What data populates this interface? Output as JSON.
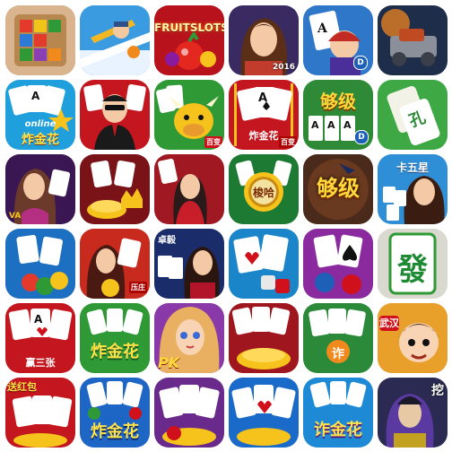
{
  "tiles": {
    "fruit_slots": {
      "title": "FRUITSLOTS"
    },
    "heroine_game": {
      "year": "2016"
    },
    "hero_d": {
      "badge": "D"
    },
    "zha_jin_hua_online": {
      "online": "online",
      "title": "炸金花"
    },
    "cow_poker": {
      "ribbon": "百变"
    },
    "red_zha_jin_hua": {
      "title": "炸金花",
      "ribbon": "百变"
    },
    "gou_ji": {
      "title": "够级",
      "badge": "D"
    },
    "mahjong_tile": {
      "glyph": "孔"
    },
    "vegas_girl": {
      "tag": "VA"
    },
    "chess_rank": {
      "rank": "梭哈"
    },
    "gou_ji_hat": {
      "title": "够级"
    },
    "ka_wu_xing": {
      "title": "卡五星"
    },
    "chip_ribbon": {
      "tag": "压庄"
    },
    "zhangzai_girl": {
      "tag": "卓毅"
    },
    "fa_mahjong": {
      "glyph": "發"
    },
    "san_zhang": {
      "title": "赢三张"
    },
    "green_zha_jin_hua": {
      "title": "炸金花"
    },
    "pk_girl": {
      "title": "PK"
    },
    "zha_blue": {
      "badge": "诈"
    },
    "wuhan_boy": {
      "title": "武汉"
    },
    "song_hong_bao": {
      "title": "送红包"
    },
    "zha_jin_hua_blue": {
      "title": "炸金花"
    },
    "zha_jin_hua_purple": {
      "title": "诈金花"
    },
    "lord_dragon": {
      "title": "挖"
    }
  },
  "colors": {
    "red": "#d0101a",
    "gold": "#f6c21c",
    "green": "#2f9a35",
    "blue": "#1e5fb8",
    "purple": "#6a2a8c"
  }
}
